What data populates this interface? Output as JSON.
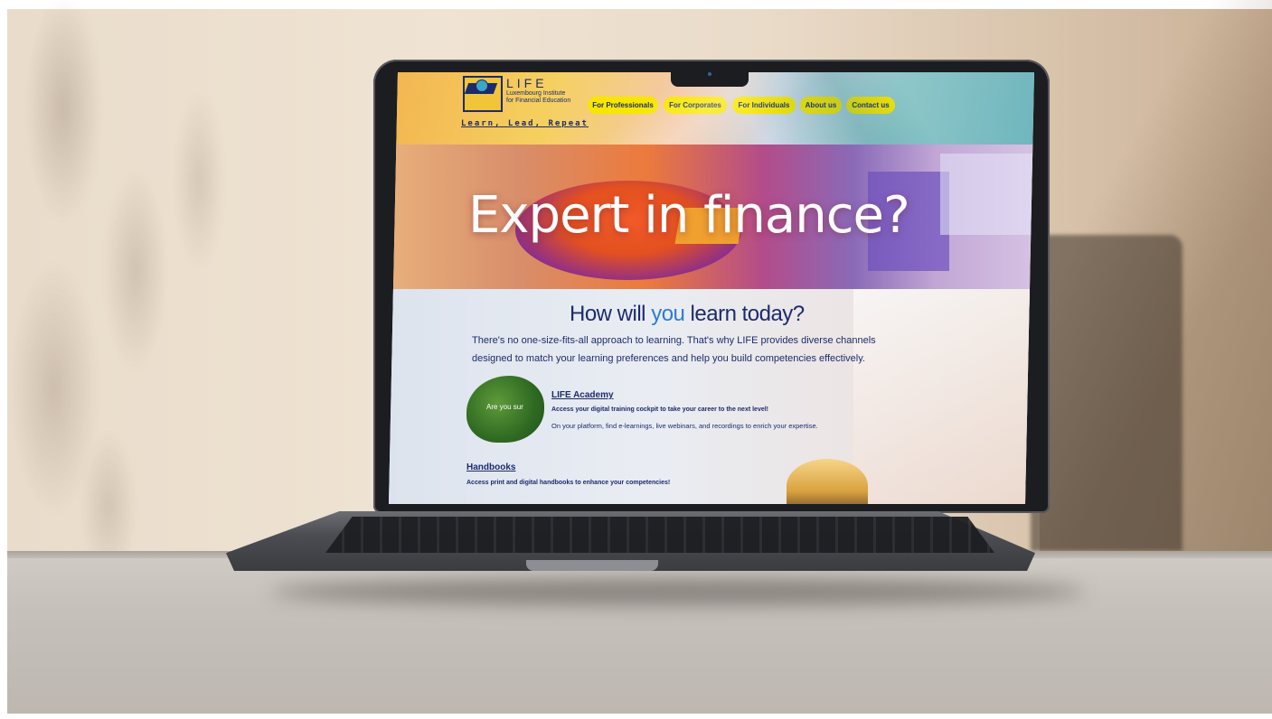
{
  "site": {
    "logo_name": "LIFE",
    "logo_sub_line1": "Luxembourg Institute",
    "logo_sub_line2": "for Financial Education",
    "tagline": "Learn, Lead, Repeat"
  },
  "nav": {
    "items": [
      {
        "label": "For Professionals"
      },
      {
        "label": "For Corporates"
      },
      {
        "label": "For Individuals"
      },
      {
        "label": "About us"
      },
      {
        "label": "Contact us"
      }
    ]
  },
  "hero": {
    "title": "Expert in finance?"
  },
  "learn": {
    "heading_before": "How will ",
    "heading_highlight": "you",
    "heading_after": " learn today?",
    "intro": "There's no one-size-fits-all approach to learning. That's why LIFE provides diverse channels designed to match your learning preferences and help you build competencies effectively."
  },
  "academy": {
    "image_caption": "Are you sur",
    "title": "LIFE Academy",
    "subtitle": "Access your digital training cockpit to take your career to the next level!",
    "description": "On your platform, find e-learnings, live webinars, and recordings to enrich your expertise."
  },
  "handbooks": {
    "title": "Handbooks",
    "subtitle": "Access print and digital handbooks to enhance your competencies!"
  },
  "colors": {
    "nav_bg": "#f8e600",
    "brand_navy": "#1c2b6b",
    "highlight_blue": "#2b7dd6"
  }
}
